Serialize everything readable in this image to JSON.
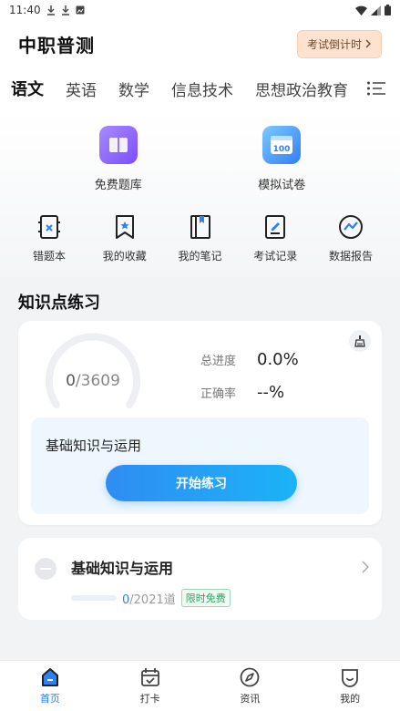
{
  "status_bar": {
    "time": "11:40"
  },
  "header": {
    "title": "中职普测",
    "countdown_label": "考试倒计时"
  },
  "subjects": [
    {
      "label": "语文",
      "active": true
    },
    {
      "label": "英语",
      "active": false
    },
    {
      "label": "数学",
      "active": false
    },
    {
      "label": "信息技术",
      "active": false
    },
    {
      "label": "思想政治教育",
      "active": false
    }
  ],
  "big_features": [
    {
      "label": "免费题库",
      "icon": "book-icon"
    },
    {
      "label": "模拟试卷",
      "icon": "exam-paper-icon"
    }
  ],
  "big_feature_badge": "100",
  "small_features": [
    {
      "label": "错题本",
      "icon": "wrong-book-icon"
    },
    {
      "label": "我的收藏",
      "icon": "bookmark-icon"
    },
    {
      "label": "我的笔记",
      "icon": "notebook-icon"
    },
    {
      "label": "考试记录",
      "icon": "record-icon"
    },
    {
      "label": "数据报告",
      "icon": "report-icon"
    }
  ],
  "section_title": "知识点练习",
  "practice": {
    "done": "0",
    "separator": "/",
    "total": "3609",
    "progress_label": "总进度",
    "progress_value": "0.0%",
    "accuracy_label": "正确率",
    "accuracy_value": "--%",
    "module_title": "基础知识与运用",
    "start_label": "开始练习"
  },
  "chapter": {
    "title": "基础知识与运用",
    "done": "0",
    "total_text": "/2021道",
    "progress": 0,
    "badge": "限时免费"
  },
  "bottom_nav": [
    {
      "label": "首页",
      "icon": "home-icon",
      "active": true
    },
    {
      "label": "打卡",
      "icon": "calendar-check-icon",
      "active": false
    },
    {
      "label": "资讯",
      "icon": "compass-icon",
      "active": false
    },
    {
      "label": "我的",
      "icon": "profile-icon",
      "active": false
    }
  ],
  "colors": {
    "accent": "#2f7ff5",
    "countdown_bg": "#fde3cf",
    "card_inner": "#eef6fe"
  }
}
